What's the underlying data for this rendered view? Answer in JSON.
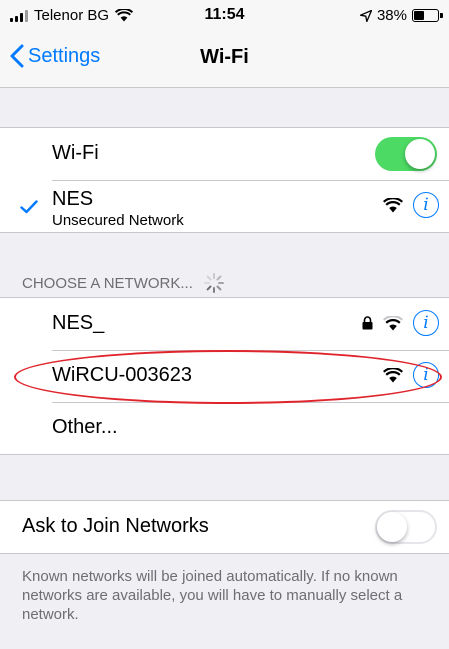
{
  "status_bar": {
    "carrier": "Telenor BG",
    "time": "11:54",
    "battery_percent": "38%",
    "battery_level": 0.38
  },
  "nav": {
    "back_label": "Settings",
    "title": "Wi-Fi"
  },
  "wifi_toggle": {
    "label": "Wi-Fi",
    "state": "on"
  },
  "connected_network": {
    "name": "NES",
    "subtitle": "Unsecured Network"
  },
  "choose_section": {
    "header": "CHOOSE A NETWORK..."
  },
  "networks": [
    {
      "name": "NES_",
      "locked": true
    },
    {
      "name": "WiRCU-003623",
      "locked": false
    },
    {
      "name": "Other..."
    }
  ],
  "ask_to_join": {
    "label": "Ask to Join Networks",
    "state": "off"
  },
  "footer": {
    "text": "Known networks will be joined automatically. If no known networks are available, you will have to manually select a network."
  },
  "colors": {
    "accent": "#007aff",
    "toggle_on": "#4cd964",
    "highlight": "#e0242b",
    "background": "#efeff4"
  }
}
